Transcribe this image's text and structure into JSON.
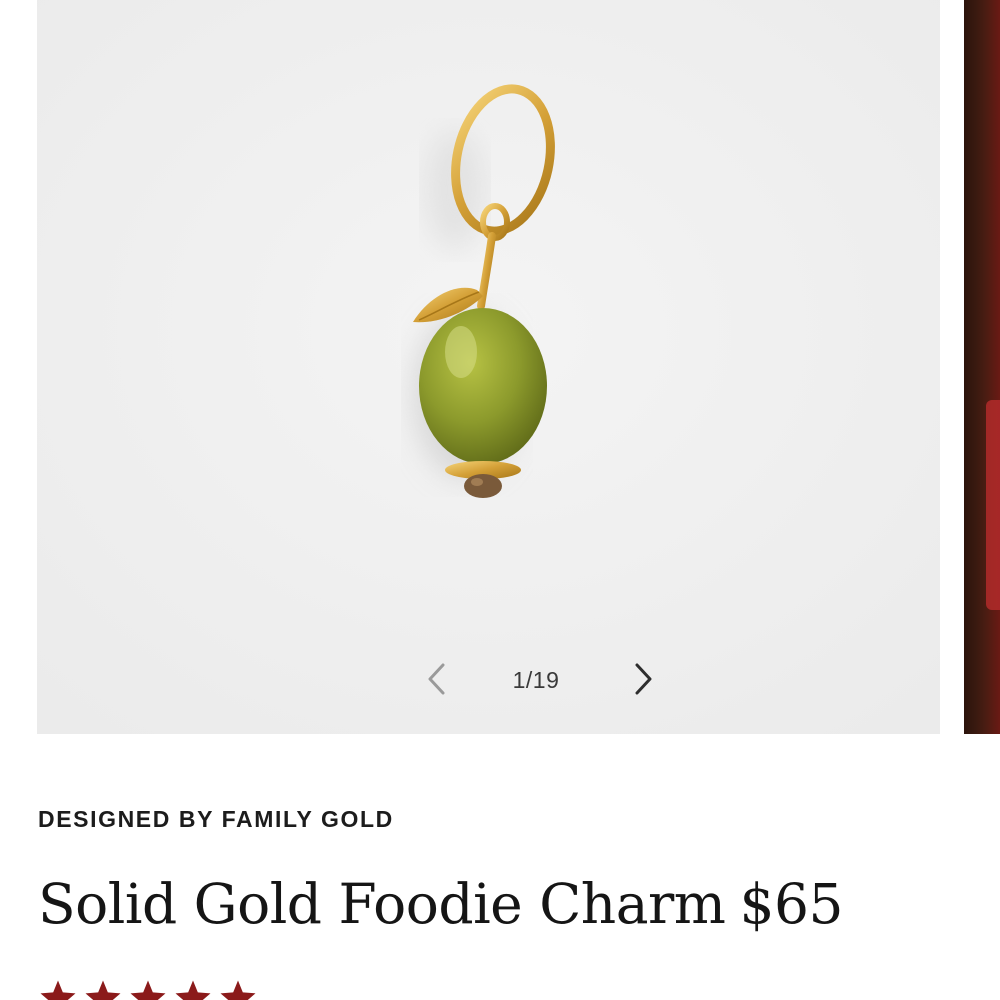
{
  "gallery": {
    "current_slide": 1,
    "total_slides": 19,
    "counter_text": "1/19",
    "background_color": "#efefef",
    "image": {
      "subject": "gold charm with green stone pendant",
      "colors": {
        "gold": "#d4a037",
        "stone": "#8a9a2a",
        "tip": "#7a5a3a"
      }
    },
    "prev_icon": "chevron-left-icon",
    "next_icon": "chevron-right-icon"
  },
  "product": {
    "brand_line": "DESIGNED BY FAMILY GOLD",
    "name": "Solid Gold Foodie Charm",
    "price": "$65"
  },
  "rating": {
    "stars": 5,
    "star_color": "#8b1a1a",
    "icon": "star-icon"
  }
}
